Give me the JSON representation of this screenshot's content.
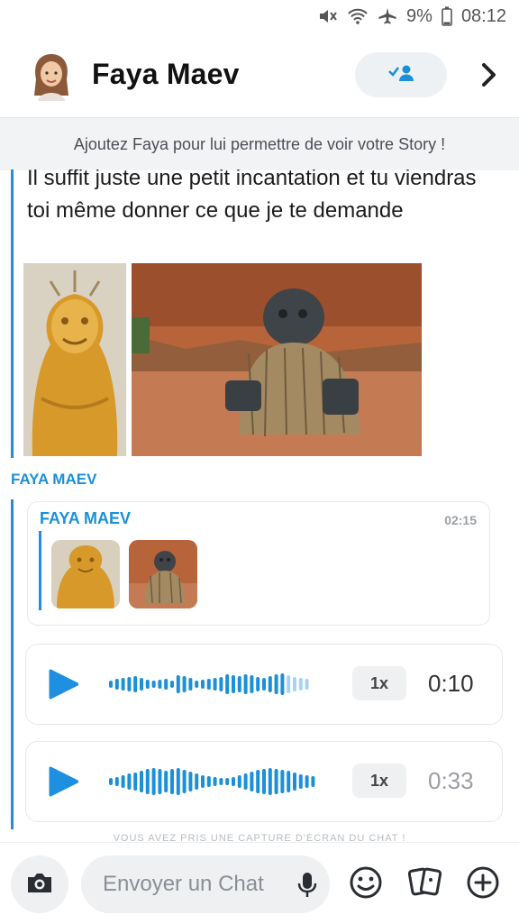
{
  "status_bar": {
    "battery": "9%",
    "time": "08:12",
    "icons": [
      "mute-icon",
      "wifi-icon",
      "airplane-icon",
      "battery-icon"
    ]
  },
  "header": {
    "contact_name": "Faya Maev",
    "friend_button_icon": "add-friend-icon",
    "next_icon": "chevron-right-icon"
  },
  "banner": {
    "text": "Ajoutez Faya pour lui permettre de voir votre Story !"
  },
  "messages": {
    "text": "Il suffit juste une petit incantation et tu viendras toi même donner ce que je te demande",
    "sender": "FAYA MAEV",
    "quote": {
      "sender": "FAYA MAEV",
      "time": "02:15"
    },
    "voice_notes": [
      {
        "speed": "1x",
        "duration": "0:10"
      },
      {
        "speed": "1x",
        "duration": "0:33"
      }
    ]
  },
  "footer_note": "VOUS AVEZ PRIS UNE CAPTURE D'ÉCRAN DU CHAT !",
  "composer": {
    "placeholder": "Envoyer un Chat",
    "icons": [
      "camera-icon",
      "mic-icon",
      "smiley-icon",
      "cards-icon",
      "plus-icon"
    ]
  },
  "colors": {
    "accent": "#1b90d8",
    "play": "#1f8fe0"
  }
}
